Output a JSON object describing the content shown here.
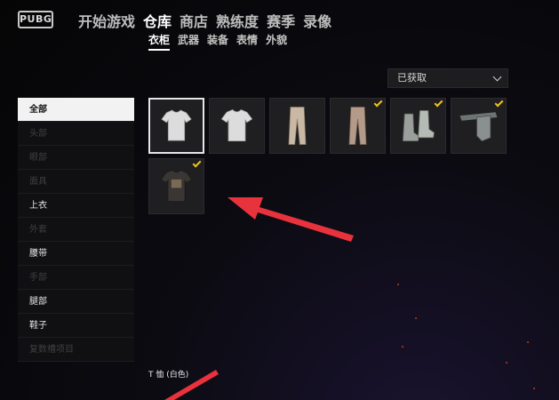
{
  "logo": {
    "text": "PUBG"
  },
  "nav": {
    "main_tabs": [
      {
        "label": "开始游戏",
        "active": false
      },
      {
        "label": "仓库",
        "active": true
      },
      {
        "label": "商店",
        "active": false
      },
      {
        "label": "熟练度",
        "active": false
      },
      {
        "label": "赛季",
        "active": false
      },
      {
        "label": "录像",
        "active": false
      }
    ],
    "sub_tabs": [
      {
        "label": "衣柜",
        "active": true
      },
      {
        "label": "武器",
        "active": false
      },
      {
        "label": "装备",
        "active": false
      },
      {
        "label": "表情",
        "active": false
      },
      {
        "label": "外貌",
        "active": false
      }
    ]
  },
  "filter": {
    "selected": "已获取",
    "icon": "chevron-down-icon"
  },
  "sidebar": {
    "items": [
      {
        "label": "全部",
        "state": "active"
      },
      {
        "label": "头部",
        "state": "disabled"
      },
      {
        "label": "眼部",
        "state": "disabled"
      },
      {
        "label": "面具",
        "state": "disabled"
      },
      {
        "label": "上衣",
        "state": "normal"
      },
      {
        "label": "外套",
        "state": "disabled"
      },
      {
        "label": "腰带",
        "state": "normal"
      },
      {
        "label": "手部",
        "state": "disabled"
      },
      {
        "label": "腿部",
        "state": "normal"
      },
      {
        "label": "鞋子",
        "state": "normal"
      },
      {
        "label": "复数槽项目",
        "state": "disabled"
      }
    ]
  },
  "grid": {
    "items": [
      {
        "icon": "white-tshirt-icon",
        "selected": true,
        "checked": false
      },
      {
        "icon": "white-tshirt-icon",
        "selected": false,
        "checked": false
      },
      {
        "icon": "beige-pants-icon",
        "selected": false,
        "checked": false
      },
      {
        "icon": "brown-pants-icon",
        "selected": false,
        "checked": true
      },
      {
        "icon": "boots-icon",
        "selected": false,
        "checked": true
      },
      {
        "icon": "belt-holster-icon",
        "selected": false,
        "checked": true
      },
      {
        "icon": "dark-graphic-tshirt-icon",
        "selected": false,
        "checked": true
      }
    ]
  },
  "selected_item": {
    "name": "T 恤 (白色)"
  },
  "colors": {
    "accent_check": "#f0c21a",
    "annotation_arrow": "#e8323c",
    "sidebar_active_bg": "#f2f2f2"
  }
}
